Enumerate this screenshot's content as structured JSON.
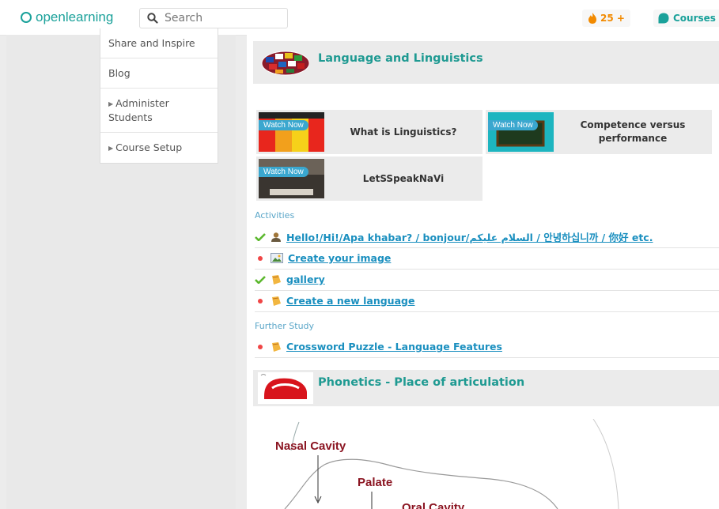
{
  "header": {
    "logo_text": "openlearning",
    "search_placeholder": "Search",
    "points": "25 +",
    "courses_label": "Courses"
  },
  "sidebar": {
    "items": [
      {
        "label": "Share and Inspire",
        "has_arrow": false
      },
      {
        "label": "Blog",
        "has_arrow": false
      },
      {
        "label": "Administer Students",
        "has_arrow": true
      },
      {
        "label": "Course Setup",
        "has_arrow": true
      }
    ]
  },
  "section1": {
    "title": "Language and Linguistics",
    "videos": [
      {
        "badge": "Watch Now",
        "title": "What is Linguistics?"
      },
      {
        "badge": "Watch Now",
        "title": "Competence versus performance"
      },
      {
        "badge": "Watch Now",
        "title": "LetSSpeakNaVi"
      }
    ],
    "activities_label": "Activities",
    "activities": [
      {
        "status": "done",
        "icon": "person-icon",
        "text": "Hello!/Hi!/Apa khabar? / bonjour/السلام عليكم / 안녕하십니까 / 你好 etc."
      },
      {
        "status": "todo",
        "icon": "image-icon",
        "text": "Create your image"
      },
      {
        "status": "done",
        "icon": "page-icon",
        "text": "gallery"
      },
      {
        "status": "todo",
        "icon": "page-icon",
        "text": "Create a new language"
      }
    ],
    "further_label": "Further Study",
    "further": [
      {
        "status": "todo",
        "icon": "page-icon",
        "text": "Crossword Puzzle - Language Features"
      }
    ]
  },
  "section2": {
    "title": "Phonetics - Place of articulation",
    "diagram_labels": {
      "nasal": "Nasal Cavity",
      "palate": "Palate",
      "oral": "Oral Cavity"
    }
  },
  "colors": {
    "brand": "#1aa19a",
    "link": "#1a8fbf",
    "points": "#f28a00",
    "todo_dot": "#f04646",
    "done_check": "#5cb82e"
  }
}
